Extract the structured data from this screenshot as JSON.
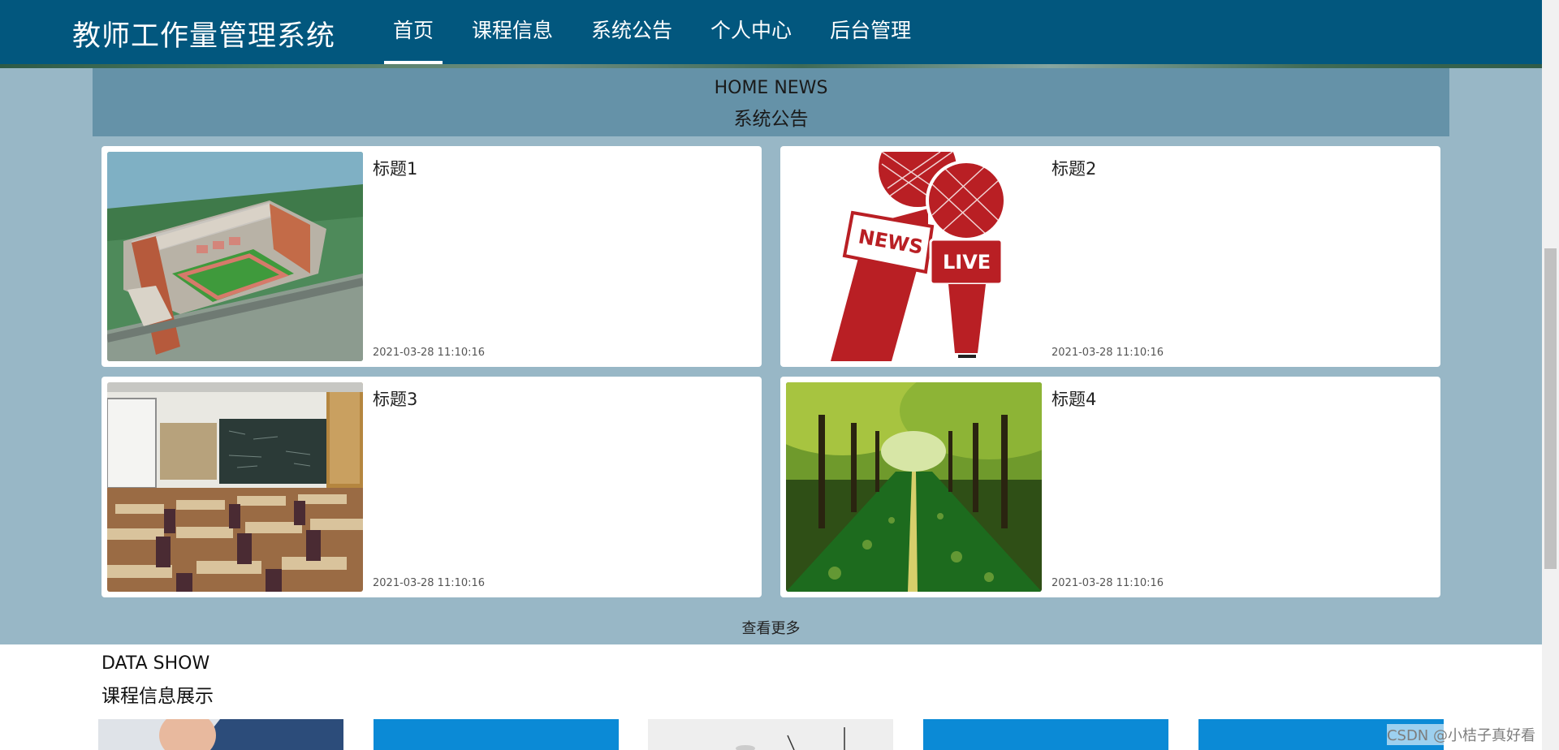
{
  "header": {
    "logo": "教师工作量管理系统",
    "nav": [
      {
        "label": "首页",
        "active": true
      },
      {
        "label": "课程信息",
        "active": false
      },
      {
        "label": "系统公告",
        "active": false
      },
      {
        "label": "个人中心",
        "active": false
      },
      {
        "label": "后台管理",
        "active": false
      }
    ]
  },
  "news": {
    "heading_en": "HOME NEWS",
    "heading_cn": "系统公告",
    "items": [
      {
        "title": "标题1",
        "date": "2021-03-28 11:10:16",
        "image": "campus-aerial-image"
      },
      {
        "title": "标题2",
        "date": "2021-03-28 11:10:16",
        "image": "news-live-microphones-image"
      },
      {
        "title": "标题3",
        "date": "2021-03-28 11:10:16",
        "image": "classroom-image"
      },
      {
        "title": "标题4",
        "date": "2021-03-28 11:10:16",
        "image": "tree-lined-road-image"
      }
    ],
    "more_label": "查看更多"
  },
  "data_show": {
    "heading_en": "DATA SHOW",
    "heading_cn": "课程信息展示"
  },
  "watermark": "CSDN @小桔子真好看",
  "colors": {
    "header_bg": "#02577e",
    "section_bg": "#98b7c6",
    "banner_bg": "#6592a8",
    "mic_red": "#b91f24",
    "course_blue": "#0b8ad6"
  }
}
